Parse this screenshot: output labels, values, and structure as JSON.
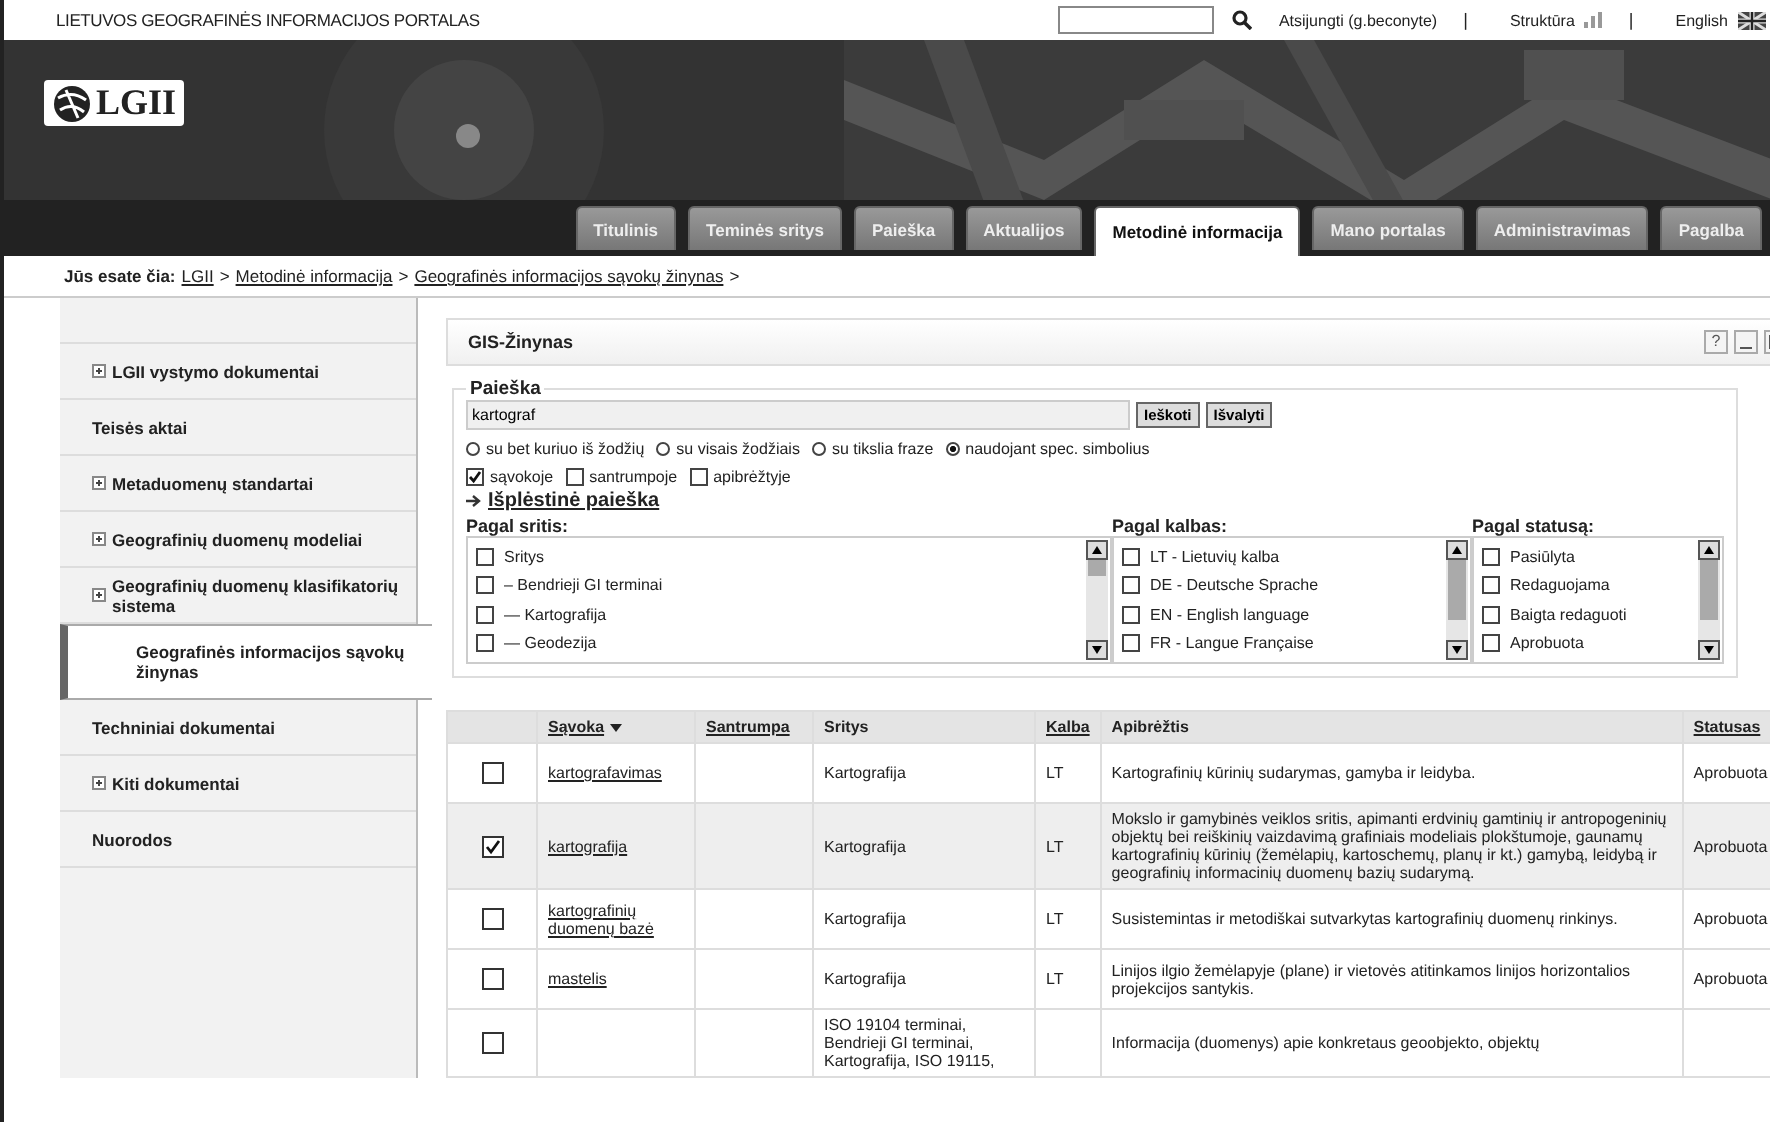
{
  "portal_title": "LIETUVOS GEOGRAFINĖS INFORMACIJOS PORTALAS",
  "user_links": [
    {
      "label": "Atsijungti (g.beconyte)",
      "kind": "plain"
    },
    {
      "label": "Struktūra",
      "kind": "structure"
    },
    {
      "label": "English",
      "kind": "language"
    }
  ],
  "link_separator": "|",
  "logo": "LGII",
  "tabs": [
    {
      "label": "Titulinis",
      "selected": false
    },
    {
      "label": "Teminės sritys",
      "selected": false
    },
    {
      "label": "Paieška",
      "selected": false
    },
    {
      "label": "Aktualijos",
      "selected": false
    },
    {
      "label": "Metodinė informacija",
      "selected": true
    },
    {
      "label": "Mano portalas",
      "selected": false
    },
    {
      "label": "Administravimas",
      "selected": false
    },
    {
      "label": "Pagalba",
      "selected": false
    }
  ],
  "breadcrumb": {
    "label": "Jūs esate čia:",
    "separator": ">",
    "items": [
      "LGII",
      "Metodinė informacija",
      "Geografinės informacijos sąvokų žinynas"
    ]
  },
  "sidebar": {
    "items": [
      {
        "label": "LGII vystymo dokumentai",
        "expandable": true,
        "selected": false
      },
      {
        "label": "Teisės aktai",
        "expandable": false,
        "selected": false
      },
      {
        "label": "Metaduomenų standartai",
        "expandable": true,
        "selected": false
      },
      {
        "label": "Geografinių duomenų modeliai",
        "expandable": true,
        "selected": false
      },
      {
        "label": "Geografinių duomenų klasifikatorių sistema",
        "expandable": true,
        "selected": false
      },
      {
        "label": "Geografinės informacijos sąvokų žinynas",
        "expandable": false,
        "selected": true
      },
      {
        "label": "Techniniai dokumentai",
        "expandable": false,
        "selected": false
      },
      {
        "label": "Kiti dokumentai",
        "expandable": true,
        "selected": false
      },
      {
        "label": "Nuorodos",
        "expandable": false,
        "selected": false
      }
    ]
  },
  "portlet": {
    "title": "GIS-Žinynas",
    "help": "?"
  },
  "search": {
    "legend": "Paieška",
    "value": "kartograf",
    "buttons": [
      "Ieškoti",
      "Išvalyti"
    ],
    "modes": [
      {
        "label": "su bet kuriuo iš žodžių",
        "selected": false
      },
      {
        "label": "su visais žodžiais",
        "selected": false
      },
      {
        "label": "su tikslia fraze",
        "selected": false
      },
      {
        "label": "naudojant spec. simbolius",
        "selected": true
      }
    ],
    "fields": [
      {
        "label": "sąvokoje",
        "checked": true
      },
      {
        "label": "santrumpoje",
        "checked": false
      },
      {
        "label": "apibrėžtyje",
        "checked": false
      }
    ],
    "advanced_link": "Išplėstinė paieška",
    "filters": [
      {
        "title": "Pagal sritis:",
        "options": [
          {
            "label": "Sritys",
            "checked": false
          },
          {
            "label": "– Bendrieji GI terminai",
            "checked": false
          },
          {
            "label": "— Kartografija",
            "checked": false
          },
          {
            "label": "— Geodezija",
            "checked": false
          }
        ]
      },
      {
        "title": "Pagal kalbas:",
        "options": [
          {
            "label": "LT - Lietuvių kalba",
            "checked": false
          },
          {
            "label": "DE - Deutsche Sprache",
            "checked": false
          },
          {
            "label": "EN - English language",
            "checked": false
          },
          {
            "label": "FR - Langue Française",
            "checked": false
          }
        ]
      },
      {
        "title": "Pagal statusą:",
        "options": [
          {
            "label": "Pasiūlyta",
            "checked": false
          },
          {
            "label": "Redaguojama",
            "checked": false
          },
          {
            "label": "Baigta redaguoti",
            "checked": false
          },
          {
            "label": "Aprobuota",
            "checked": false
          }
        ]
      }
    ]
  },
  "table": {
    "columns": [
      {
        "label": "Sąvoka",
        "link": true,
        "sorted": true
      },
      {
        "label": "Santrumpa",
        "link": true,
        "sorted": false
      },
      {
        "label": "Sritys",
        "link": false,
        "sorted": false
      },
      {
        "label": "Kalba",
        "link": true,
        "sorted": false
      },
      {
        "label": "Apibrėžtis",
        "link": false,
        "sorted": false
      },
      {
        "label": "Statusas",
        "link": true,
        "sorted": false
      }
    ],
    "rows": [
      {
        "checked": false,
        "term": "kartografavimas",
        "areas": "Kartografija",
        "lang": "LT",
        "definition": "Kartografinių kūrinių sudarymas, gamyba ir leidyba.",
        "status": "Aprobuota"
      },
      {
        "checked": true,
        "term": "kartografija",
        "areas": "Kartografija",
        "lang": "LT",
        "definition": "Mokslo ir gamybinės veiklos sritis, apimanti erdvinių gamtinių ir antropogeninių objektų bei reiškinių vaizdavimą grafiniais modeliais plokštumoje, gaunamų kartografinių kūrinių (žemėlapių, kartoschemų, planų ir kt.) gamybą, leidybą ir geografinių informacinių duomenų bazių sudarymą.",
        "status": "Aprobuota"
      },
      {
        "checked": false,
        "term": "kartografinių duomenų bazė",
        "areas": "Kartografija",
        "lang": "LT",
        "definition": "Susistemintas ir metodiškai sutvarkytas kartografinių duomenų rinkinys.",
        "status": "Aprobuota"
      },
      {
        "checked": false,
        "term": "mastelis",
        "areas": "Kartografija",
        "lang": "LT",
        "definition": "Linijos ilgio žemėlapyje (plane) ir vietovės atitinkamos linijos horizontalios projekcijos santykis.",
        "status": "Aprobuota"
      },
      {
        "checked": false,
        "areas": "ISO 19104 terminai, Bendrieji GI terminai, Kartografija, ISO 19115,",
        "definition": "Informacija (duomenys) apie konkretaus geoobjekto, objektų"
      }
    ]
  }
}
